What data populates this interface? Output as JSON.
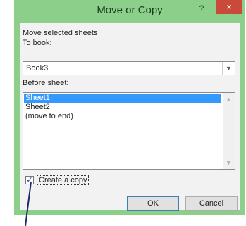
{
  "window": {
    "title": "Move or Copy",
    "help_glyph": "?",
    "close_glyph": "×",
    "accent_color": "#8bcf8b",
    "close_color": "#c94a3a"
  },
  "form": {
    "move_label": "Move selected sheets",
    "to_book_label": "To book:",
    "to_book_value": "Book3",
    "before_sheet_label": "Before sheet:",
    "sheets": [
      "Sheet1",
      "Sheet2",
      "(move to end)"
    ],
    "selected_sheet": "Sheet1",
    "create_copy_label": "Create a copy",
    "create_copy_checked": true,
    "check_glyph": "✓"
  },
  "buttons": {
    "ok_label": "OK",
    "cancel_label": "Cancel"
  },
  "icons": {
    "combo_arrow": "chevron-down-icon",
    "scroll_up": "chevron-up-icon",
    "scroll_down": "chevron-down-icon"
  }
}
